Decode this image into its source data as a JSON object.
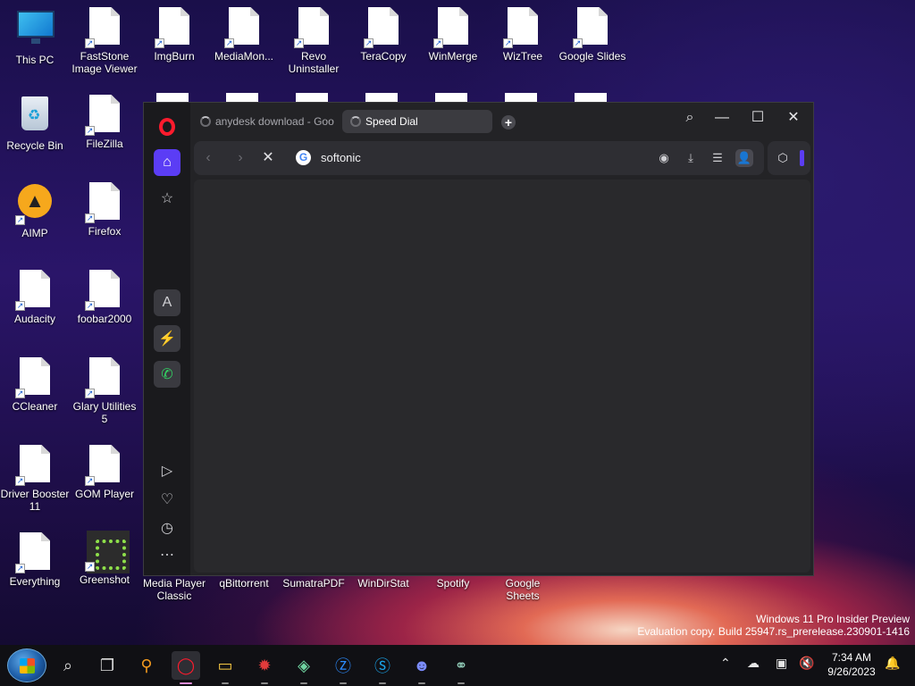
{
  "desktop": {
    "icons": [
      {
        "label": "This PC"
      },
      {
        "label": "FastStone Image Viewer"
      },
      {
        "label": "ImgBurn"
      },
      {
        "label": "MediaMon..."
      },
      {
        "label": "Revo Uninstaller"
      },
      {
        "label": "TeraCopy"
      },
      {
        "label": "WinMerge"
      },
      {
        "label": "WizTree"
      },
      {
        "label": "Google Slides"
      },
      {
        "label": "Recycle Bin"
      },
      {
        "label": "FileZilla"
      },
      {
        "label": "AIMP"
      },
      {
        "label": "Firefox"
      },
      {
        "label": "Audacity"
      },
      {
        "label": "foobar2000"
      },
      {
        "label": "CCleaner"
      },
      {
        "label": "Glary Utilities 5"
      },
      {
        "label": "Driver Booster 11"
      },
      {
        "label": "GOM Player"
      },
      {
        "label": "Everything"
      },
      {
        "label": "Greenshot"
      },
      {
        "label": "Media Player Classic"
      },
      {
        "label": "qBittorrent"
      },
      {
        "label": "SumatraPDF"
      },
      {
        "label": "WinDirStat"
      },
      {
        "label": "Spotify"
      },
      {
        "label": "Google Sheets"
      }
    ]
  },
  "browser": {
    "tabs": [
      {
        "title": "anydesk download - Goo",
        "state": "loading"
      },
      {
        "title": "Speed Dial",
        "state": "loading",
        "active": true
      }
    ],
    "address": "softonic",
    "colors": {
      "accent": "#5b3df5",
      "brand": "#ff1b2d",
      "bg": "#232326"
    }
  },
  "watermark": {
    "line1": "Windows 11 Pro Insider Preview",
    "line2": "Evaluation copy. Build 25947.rs_prerelease.230901-1416"
  },
  "taskbar": {
    "time": "7:34 AM",
    "date": "9/26/2023"
  }
}
